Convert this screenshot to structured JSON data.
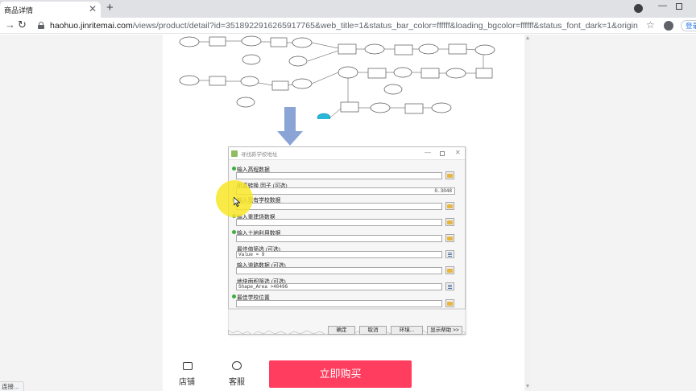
{
  "browser": {
    "tab_title": "商品详情",
    "url_host": "haohuo.jinritemai.com",
    "url_rest": "/views/product/detail?id=3518922916265917765&web_title=1&status_bar_color=ffffff&loading_bgcolor=ffffff&status_font_dark=1&origin_type=&origin_id=&...",
    "login_label": "登录"
  },
  "dialog": {
    "title": "寻找新学校地址",
    "fields": [
      {
        "label": "输入高程数据",
        "value": "",
        "required": true
      },
      {
        "label": "距离转换 因子 (可选)",
        "value": "0.3048",
        "required": false
      },
      {
        "label": "输入现有学校数据",
        "value": "",
        "required": true
      },
      {
        "label": "输入重建场数据",
        "value": "",
        "required": true
      },
      {
        "label": "输入土地利用数据",
        "value": "",
        "required": true
      },
      {
        "label": "最佳值筛选 (可选)",
        "value": "Value = 9",
        "required": false
      },
      {
        "label": "输入道路数据 (可选)",
        "value": "",
        "required": false
      },
      {
        "label": "地块面积筛选 (可选)",
        "value": "Shape_Area >40496",
        "required": false
      },
      {
        "label": "最佳学校位置",
        "value": "",
        "required": true
      }
    ],
    "buttons": [
      "确定",
      "取消",
      "环境...",
      "显示帮助 >>"
    ]
  },
  "bottom": {
    "shop_label": "店铺",
    "cs_label": "客服",
    "buy_label": "立即购买"
  },
  "status_text": "连接...",
  "colors": {
    "buy_button": "#ff3d5f",
    "highlight": "#f8e628",
    "flow_arrow": "#8aa4d6",
    "flow_node_cyan": "#29b6d8"
  }
}
